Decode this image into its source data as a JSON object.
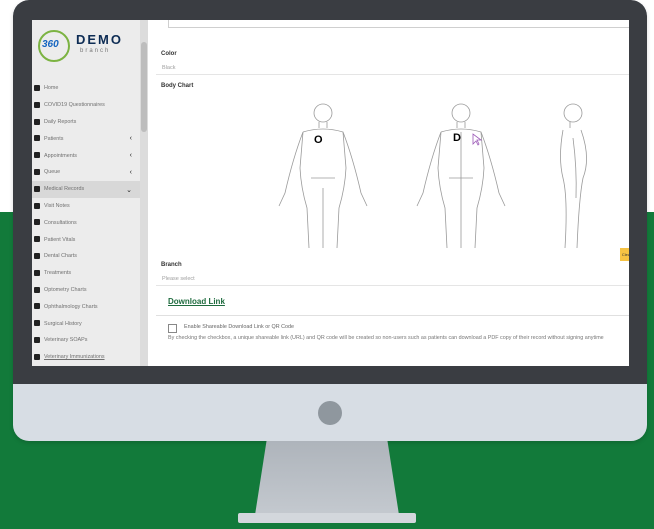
{
  "brand": {
    "logo_number": "360",
    "name": "DEMO",
    "subtitle": "branch"
  },
  "sidebar": {
    "items": [
      {
        "label": "Home"
      },
      {
        "label": "COVID19 Questionnaires"
      },
      {
        "label": "Daily Reports"
      },
      {
        "label": "Patients",
        "chevron": "‹"
      },
      {
        "label": "Appointments",
        "chevron": "‹"
      },
      {
        "label": "Queue",
        "chevron": "‹"
      },
      {
        "label": "Medical Records",
        "chevron": "⌄"
      },
      {
        "label": "Visit Notes"
      },
      {
        "label": "Consultations"
      },
      {
        "label": "Patient Vitals"
      },
      {
        "label": "Dental Charts"
      },
      {
        "label": "Treatments"
      },
      {
        "label": "Optometry Charts"
      },
      {
        "label": "Ophthalmology Charts"
      },
      {
        "label": "Surgical History"
      },
      {
        "label": "Veterinary SOAPs"
      },
      {
        "label": "Veterinary Immunizations"
      }
    ]
  },
  "form": {
    "color_label": "Color",
    "color_value": "Black",
    "body_chart_label": "Body Chart",
    "body_chart_marks": [
      "O",
      "D"
    ],
    "side_button_label": "Clea",
    "branch_label": "Branch",
    "branch_placeholder": "Please select",
    "download_link_label": "Download Link",
    "shareable_checkbox_label": "Enable Shareable Download Link or QR Code",
    "shareable_description": "By checking the checkbox, a unique shareable link (URL) and QR code will be created so non-users such as patients can download a PDF copy of their record without signing anytime"
  },
  "colors": {
    "brand_green": "#127a3a",
    "link_green": "#1e6b3e",
    "accent_yellow": "#f6c343"
  }
}
